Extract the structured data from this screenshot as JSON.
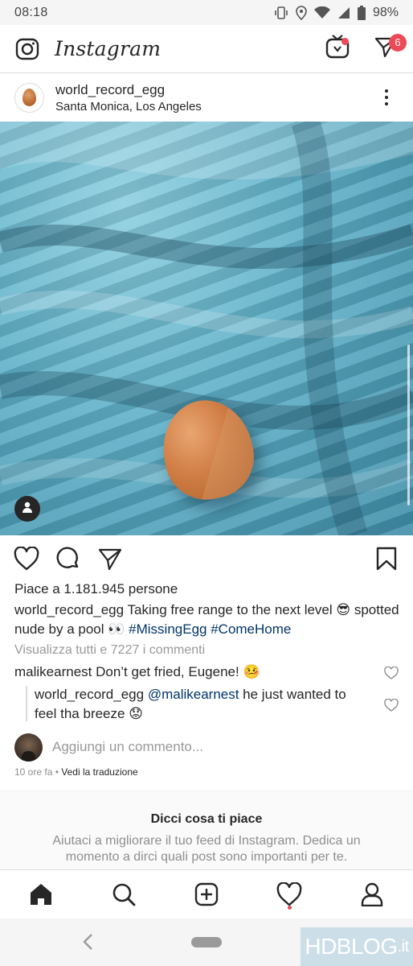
{
  "status_bar": {
    "time": "08:18",
    "battery": "98%"
  },
  "header": {
    "brand": "Instagram",
    "dm_badge": "6"
  },
  "post": {
    "username": "world_record_egg",
    "location": "Santa Monica, Los Angeles",
    "likes_text": "Piace a 1.181.945 persone",
    "caption_user": "world_record_egg",
    "caption_text": " Taking free range to the next level 😎 spotted nude by a pool 👀 ",
    "caption_tags": "#MissingEgg #ComeHome",
    "view_comments": "Visualizza tutti e 7227 i commenti",
    "comments": [
      {
        "user": "malikearnest",
        "text": " Don’t get fried, Eugene! 🤒",
        "mention": ""
      },
      {
        "user": "world_record_egg",
        "mention": " @malikearnest",
        "text": " he just wanted to feel tha breeze 😟"
      }
    ],
    "add_comment_placeholder": "Aggiungi un commento...",
    "time_ago": "10 ore fa",
    "translation": "Vedi la traduzione"
  },
  "suggest": {
    "title": "Dicci cosa ti piace",
    "body": "Aiutaci a migliorare il tuo feed di Instagram. Dedica un momento a dirci quali post sono importanti per te."
  },
  "watermark": {
    "brand": "HDBLOG",
    "suffix": ".it"
  },
  "icons": {
    "camera": "camera-icon",
    "igtv": "igtv-icon",
    "direct": "direct-send-icon",
    "like": "heart-icon",
    "comment": "comment-icon",
    "share": "share-icon",
    "save": "bookmark-icon",
    "home": "home-icon",
    "search": "search-icon",
    "new_post": "add-post-icon",
    "activity": "heart-icon",
    "profile": "profile-icon"
  },
  "colors": {
    "badge": "#ed4956",
    "link": "#003569",
    "muted": "#8e8e8e"
  }
}
